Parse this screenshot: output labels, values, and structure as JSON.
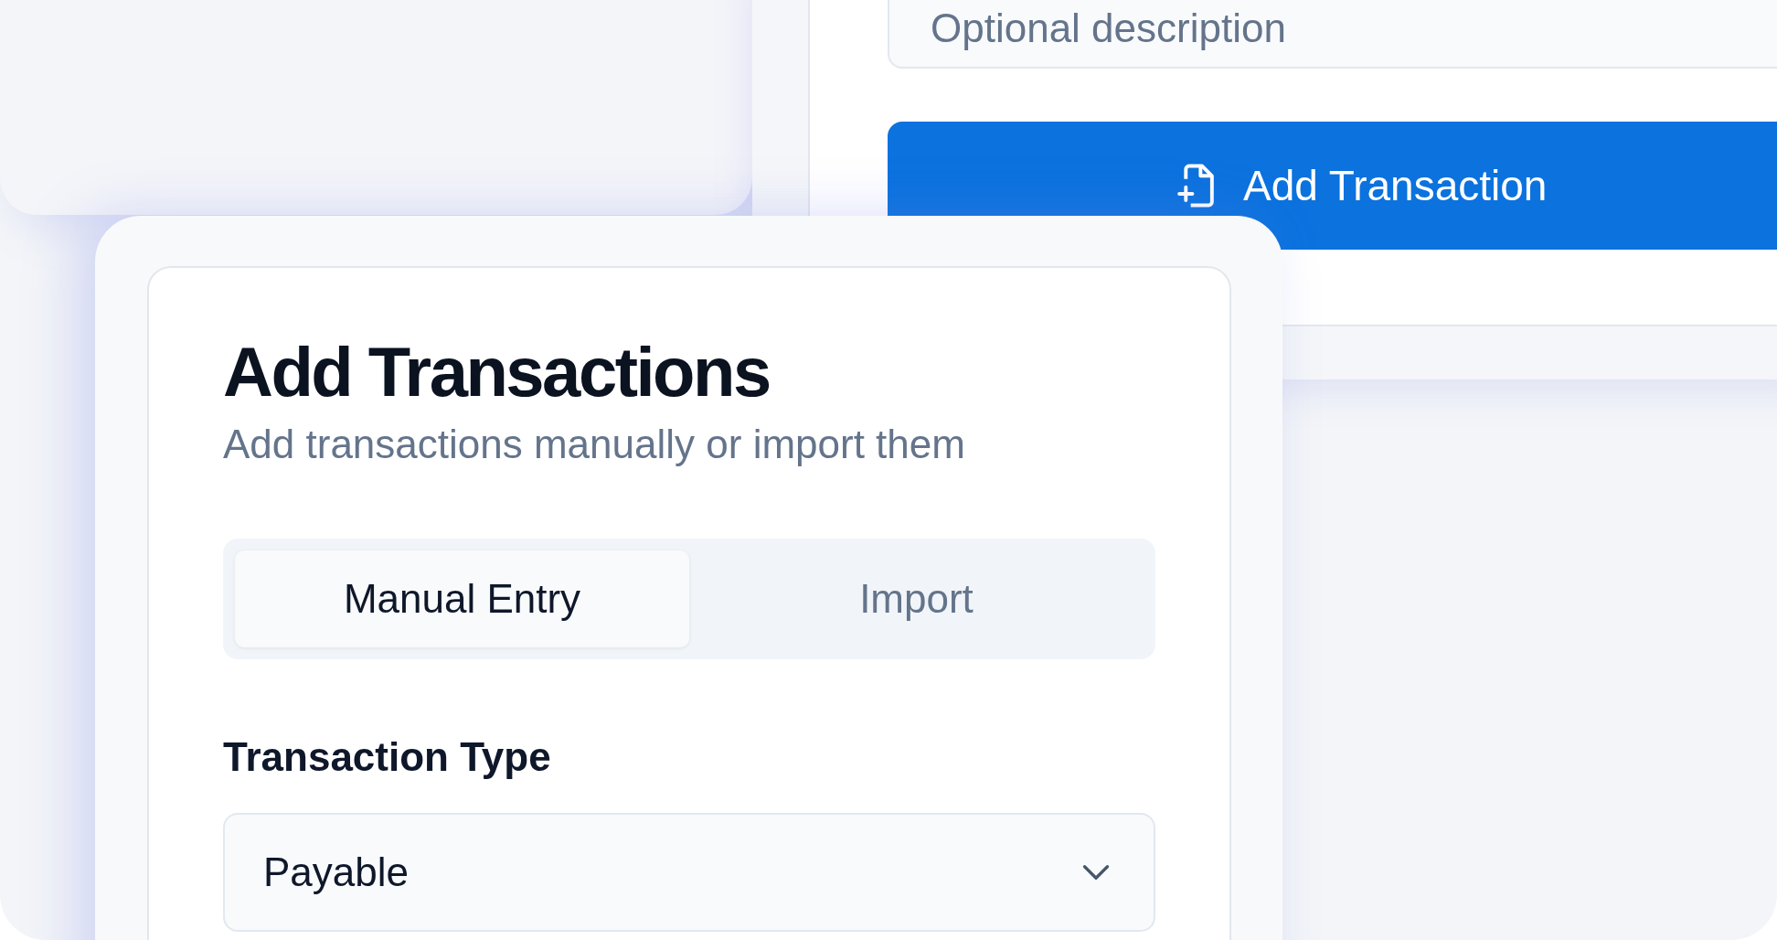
{
  "background_form": {
    "description_field": {
      "placeholder": "Optional description"
    },
    "submit_button": {
      "label": "Add Transaction"
    }
  },
  "dialog": {
    "title": "Add Transactions",
    "subtitle": "Add transactions manually or import them",
    "tabs": [
      {
        "label": "Manual Entry",
        "selected": true
      },
      {
        "label": "Import",
        "selected": false
      }
    ],
    "fields": [
      {
        "kind": "select",
        "label": "Transaction Type",
        "value": "Payable"
      }
    ]
  }
}
